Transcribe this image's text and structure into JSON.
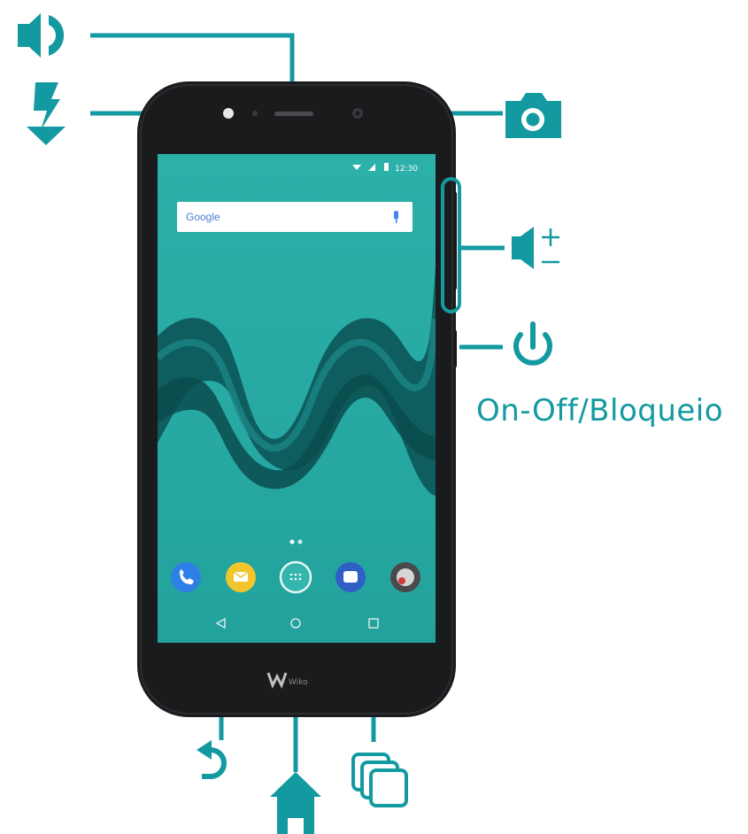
{
  "colors": {
    "accent": "#139aa1",
    "screen": "#2aa9a4",
    "phone_body": "#1a1b1d"
  },
  "labels": {
    "power": "On-Off/Bloqueio"
  },
  "screen": {
    "status_time": "12:30",
    "search_logo": "Google",
    "brand": "Wiko"
  },
  "icons": {
    "speaker": "speaker-icon",
    "flash": "flash-icon",
    "camera": "camera-icon",
    "volume": "volume-icon",
    "power": "power-icon",
    "back": "back-icon",
    "home": "home-icon",
    "recent": "recent-apps-icon"
  }
}
